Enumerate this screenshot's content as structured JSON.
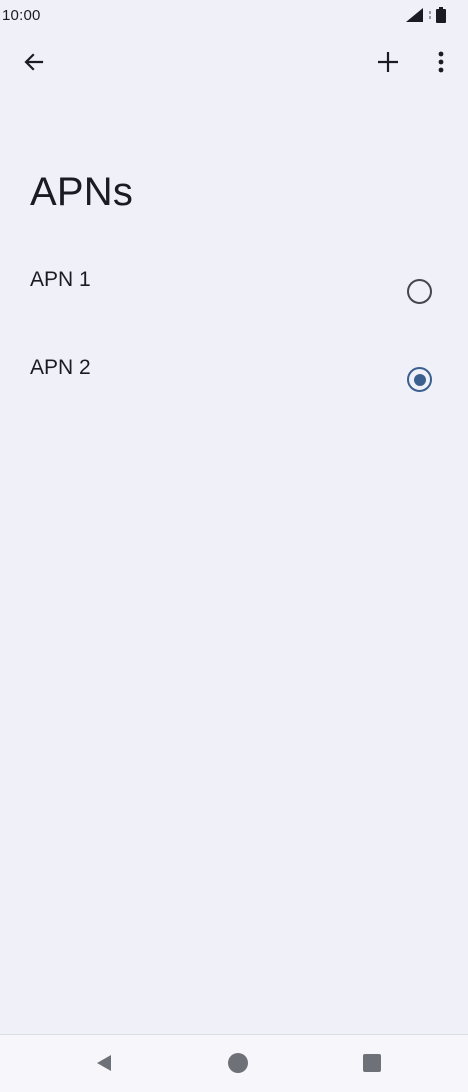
{
  "status_bar": {
    "time": "10:00",
    "icons": [
      "signal-icon",
      "battery-icon"
    ]
  },
  "app_bar": {
    "back_icon": "arrow-back-icon",
    "add_icon": "plus-icon",
    "more_icon": "more-vertical-icon"
  },
  "page": {
    "title": "APNs"
  },
  "apns": [
    {
      "label": "APN 1",
      "selected": false
    },
    {
      "label": "APN 2",
      "selected": true
    }
  ],
  "nav_bar": {
    "icons": [
      "nav-back-icon",
      "nav-home-icon",
      "nav-recents-icon"
    ]
  },
  "colors": {
    "background": "#f0f1f8",
    "accent": "#3b5f8f",
    "text": "#1b1c21"
  }
}
